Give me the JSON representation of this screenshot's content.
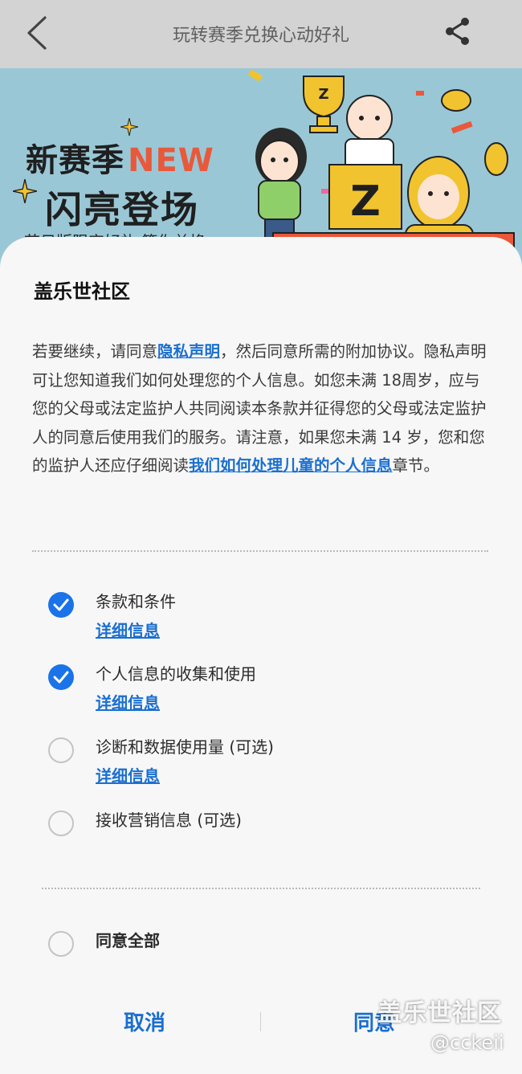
{
  "header": {
    "title": "玩转赛季兑换心动好礼",
    "back_icon": "chevron-left-icon",
    "share_icon": "share-icon"
  },
  "banner": {
    "line1_prefix": "新赛季",
    "line1_highlight": "NEW",
    "line2": "闪亮登场",
    "line3": "节日版限定好礼 等你兑换",
    "badge_letter": "Z",
    "colors": {
      "background": "#9ac7d6",
      "highlight": "#e8593b"
    }
  },
  "dialog": {
    "title": "盖乐世社区",
    "description": {
      "p1": "若要继续，请同意",
      "link1": "隐私声明",
      "p2": "，然后同意所需的附加协议。隐私声明可让您知道我们如何处理您的个人信息。如您未满 18周岁，应与您的父母或法定监护人共同阅读本条款并征得您的父母或法定监护人的同意后使用我们的服务。请注意，如果您未满 14 岁，您和您的监护人还应仔细阅读",
      "link2": "我们如何处理儿童的个人信息",
      "p3": "章节。"
    },
    "items": [
      {
        "label": "条款和条件",
        "link": "详细信息",
        "checked": true
      },
      {
        "label": "个人信息的收集和使用",
        "link": "详细信息",
        "checked": true
      },
      {
        "label": "诊断和数据使用量 (可选)",
        "link": "详细信息",
        "checked": false
      },
      {
        "label": "接收营销信息 (可选)",
        "checked": false
      }
    ],
    "agree_all": {
      "label": "同意全部",
      "checked": false
    },
    "buttons": {
      "cancel": "取消",
      "agree": "同意"
    }
  },
  "watermark": {
    "text": "盖乐世社区",
    "user": "@cckeii"
  },
  "accent_color": "#1a73e8"
}
